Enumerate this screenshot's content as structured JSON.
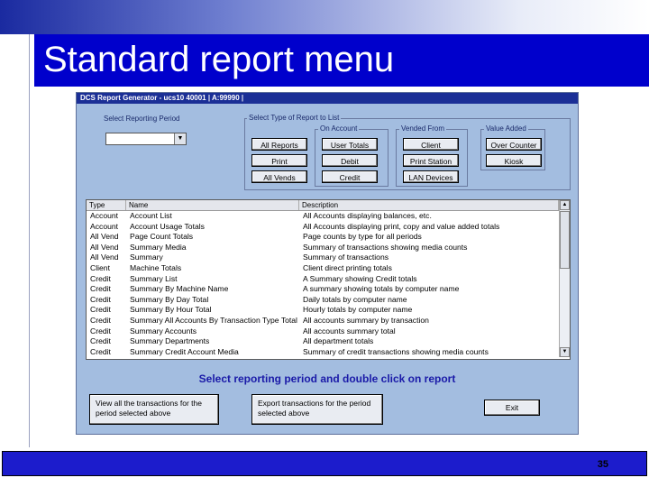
{
  "slide": {
    "title": "Standard report menu",
    "page_number": "35",
    "colors": {
      "band": "#0000cc",
      "window": "#a3bde0",
      "footer": "#1c1ccc"
    }
  },
  "window": {
    "title": "DCS Report Generator  -  ucs10  40001 | A:99990 |"
  },
  "period": {
    "label": "Select Reporting Period",
    "value": "",
    "icon": "chevron-down-icon"
  },
  "report_types": {
    "label": "Select Type of Report to List",
    "all_reports": "All Reports",
    "print": "Print",
    "all_vends": "All Vends",
    "on_account_label": "On Account",
    "user_totals": "User Totals",
    "debit": "Debit",
    "credit": "Credit",
    "vended_from_label": "Vended From",
    "client": "Client",
    "print_station": "Print Station",
    "lan_devices": "LAN Devices",
    "value_added_label": "Value Added",
    "over_counter": "Over Counter",
    "kiosk": "Kiosk"
  },
  "list": {
    "headers": {
      "type": "Type",
      "name": "Name",
      "description": "Description"
    },
    "rows": [
      {
        "type": "Account",
        "name": "Account List",
        "description": "All Accounts displaying balances, etc."
      },
      {
        "type": "Account",
        "name": "Account Usage Totals",
        "description": "All Accounts displaying print, copy and value added totals"
      },
      {
        "type": "All Vend",
        "name": "Page Count Totals",
        "description": "Page counts by type for all periods"
      },
      {
        "type": "All Vend",
        "name": "Summary Media",
        "description": "Summary of transactions showing media counts"
      },
      {
        "type": "All Vend",
        "name": "Summary",
        "description": "Summary of transactions"
      },
      {
        "type": "Client",
        "name": "Machine Totals",
        "description": "Client direct printing totals"
      },
      {
        "type": "Credit",
        "name": "Summary List",
        "description": "A Summary showing Credit totals"
      },
      {
        "type": "Credit",
        "name": "Summary By Machine Name",
        "description": "A summary showing totals by computer name"
      },
      {
        "type": "Credit",
        "name": "Summary By Day Total",
        "description": "Daily totals by computer name"
      },
      {
        "type": "Credit",
        "name": "Summary By Hour Total",
        "description": "Hourly totals by computer name"
      },
      {
        "type": "Credit",
        "name": "Summary All Accounts By Transaction Type Total",
        "description": "All accounts summary by transaction"
      },
      {
        "type": "Credit",
        "name": "Summary Accounts",
        "description": "All accounts summary total"
      },
      {
        "type": "Credit",
        "name": "Summary Departments",
        "description": "All department totals"
      },
      {
        "type": "Credit",
        "name": "Summary Credit Account Media",
        "description": "Summary of credit transactions showing media counts"
      }
    ]
  },
  "instruction": "Select reporting period and double click on report",
  "actions": {
    "view_transactions": "View all the transactions for the period selected above",
    "export_transactions": "Export transactions for the period selected above",
    "exit": "Exit"
  }
}
